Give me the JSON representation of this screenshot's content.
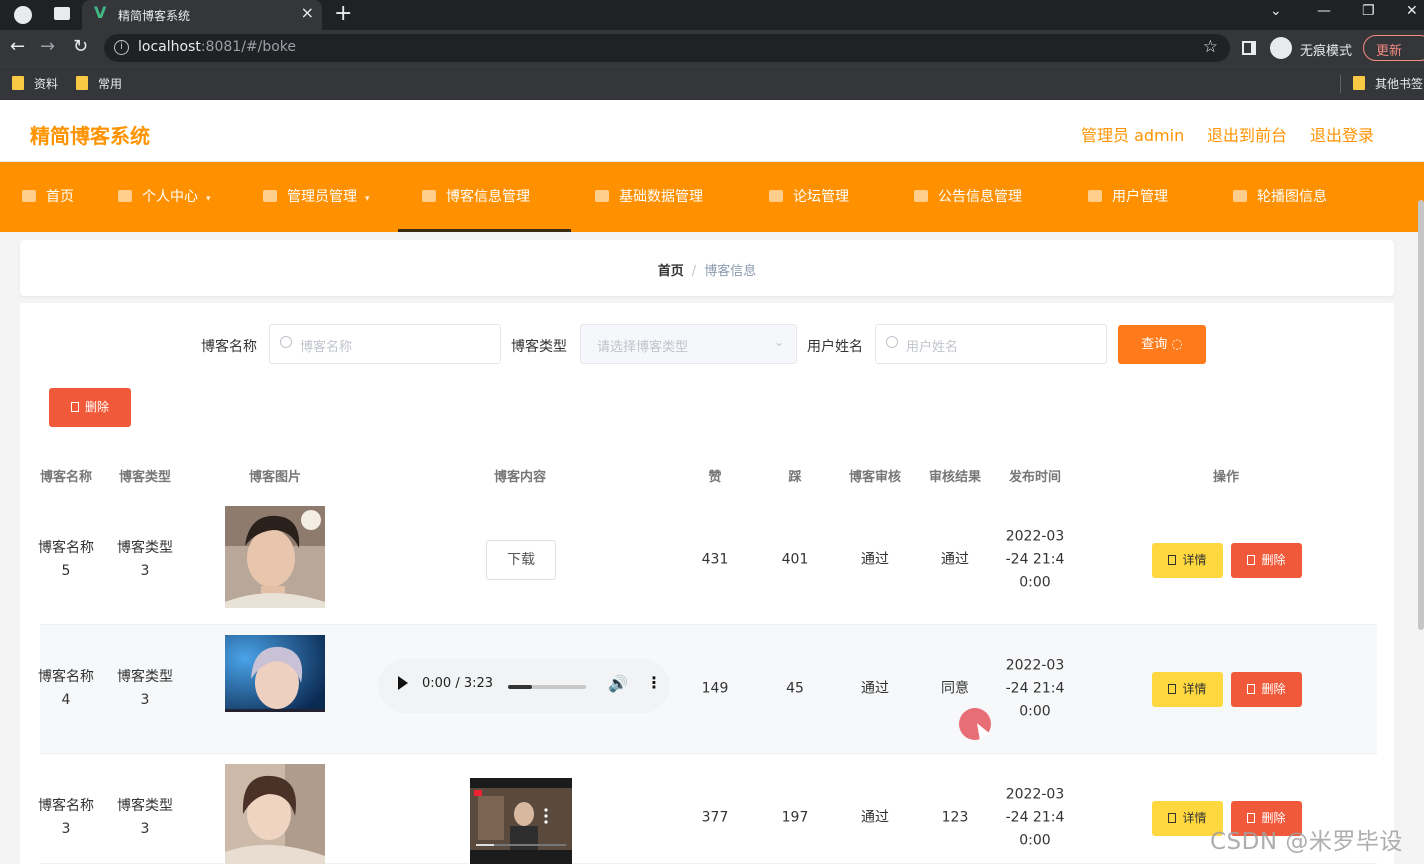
{
  "browser": {
    "tab_title": "精简博客系统",
    "url_host": "localhost",
    "url_rest": ":8081/#/boke",
    "incognito_label": "无痕模式",
    "update_label": "更新",
    "bookmarks": [
      "资料",
      "常用"
    ],
    "other_bookmarks": "其他书签"
  },
  "header": {
    "site_title": "精简博客系统",
    "admin_label": "管理员 admin",
    "back_front": "退出到前台",
    "logout": "退出登录"
  },
  "menu": [
    {
      "label": "首页"
    },
    {
      "label": "个人中心"
    },
    {
      "label": "管理员管理"
    },
    {
      "label": "博客信息管理"
    },
    {
      "label": "基础数据管理"
    },
    {
      "label": "论坛管理"
    },
    {
      "label": "公告信息管理"
    },
    {
      "label": "用户管理"
    },
    {
      "label": "轮播图信息"
    }
  ],
  "breadcrumb": {
    "home": "首页",
    "separator": "/",
    "current": "博客信息"
  },
  "search": {
    "name_label": "博客名称",
    "name_placeholder": "博客名称",
    "type_label": "博客类型",
    "type_placeholder": "请选择博客类型",
    "user_label": "用户姓名",
    "user_placeholder": "用户姓名",
    "query_label": "查询 ◌",
    "delete_label": "删除"
  },
  "table": {
    "columns": [
      "博客名称",
      "博客类型",
      "博客图片",
      "博客内容",
      "赞",
      "踩",
      "博客审核",
      "审核结果",
      "发布时间",
      "操作"
    ],
    "rows": [
      {
        "name_line1": "博客名称",
        "name_line2": "5",
        "type_line1": "博客类型",
        "type_line2": "3",
        "content_button": "下载",
        "likes": "431",
        "dislikes": "401",
        "review": "通过",
        "result": "通过",
        "time_line1": "2022-03",
        "time_line2": "-24 21:4",
        "time_line3": "0:00"
      },
      {
        "name_line1": "博客名称",
        "name_line2": "4",
        "type_line1": "博客类型",
        "type_line2": "3",
        "audio_time": "0:00 / 3:23",
        "likes": "149",
        "dislikes": "45",
        "review": "通过",
        "result": "同意",
        "time_line1": "2022-03",
        "time_line2": "-24 21:4",
        "time_line3": "0:00"
      },
      {
        "name_line1": "博客名称",
        "name_line2": "3",
        "type_line1": "博客类型",
        "type_line2": "3",
        "likes": "377",
        "dislikes": "197",
        "review": "通过",
        "result": "123",
        "time_line1": "2022-03",
        "time_line2": "-24 21:4",
        "time_line3": "0:00"
      }
    ],
    "detail_label": "详情",
    "delete_label": "删除"
  },
  "watermark": "CSDN @米罗毕设"
}
